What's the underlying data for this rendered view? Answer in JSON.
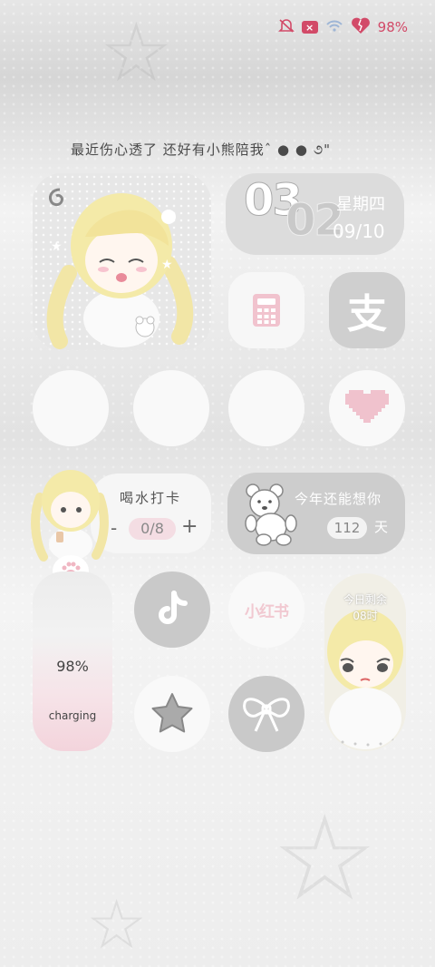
{
  "status_bar": {
    "battery_text": "98%",
    "icons": [
      "mute-icon",
      "x-box-icon",
      "wifi-icon",
      "broken-heart-battery-icon"
    ],
    "accent_color": "#d24a68"
  },
  "tagline": "最近伤心透了 还好有小熊陪我ˆ ● ● ૭\"",
  "date_widget": {
    "day_digits": "03",
    "month_digits": "02",
    "weekday": "星期四",
    "date": "09/10"
  },
  "apps": {
    "calculator": "calculator-icon",
    "alipay": "支",
    "tiktok": "tiktok-icon",
    "xiaohongshu": "小红书",
    "star": "star-icon",
    "bow": "bow-icon"
  },
  "water_widget": {
    "title": "喝水打卡",
    "count": "0/8",
    "minus": "-",
    "plus": "+"
  },
  "miss_widget": {
    "title": "今年还能想你",
    "days": "112",
    "unit": "天"
  },
  "battery_widget": {
    "percent": "98%",
    "status": "charging",
    "level": 0.98
  },
  "today_widget": {
    "title": "今日剩余",
    "value": "08时"
  }
}
